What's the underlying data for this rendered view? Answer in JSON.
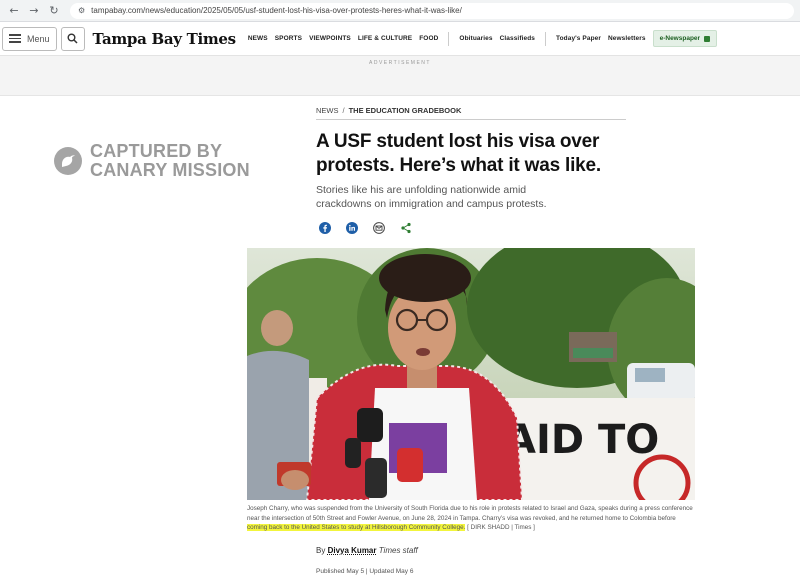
{
  "browser": {
    "url": "tampabay.com/news/education/2025/05/05/usf-student-lost-his-visa-over-protests-heres-what-it-was-like/"
  },
  "header": {
    "menu_label": "Menu",
    "logo": "Tampa Bay Times",
    "nav": [
      "NEWS",
      "SPORTS",
      "VIEWPOINTS",
      "LIFE & CULTURE",
      "FOOD"
    ],
    "nav_secondary": [
      "Obituaries",
      "Classifieds"
    ],
    "nav_tertiary": [
      "Today's Paper",
      "Newsletters"
    ],
    "epaper_label": "e-Newspaper"
  },
  "ad": {
    "label": "ADVERTISEMENT"
  },
  "watermark": {
    "line1": "CAPTURED BY",
    "line2": "CANARY MISSION"
  },
  "article": {
    "section": "NEWS",
    "subsection": "THE EDUCATION GRADEBOOK",
    "headline": "A USF student lost his visa over protests. Here’s what it was like.",
    "dek": "Stories like his are unfolding nationwide amid crackdowns on immigration and campus protests.",
    "caption_before": "Joseph Charry, who was suspended from the University of South Florida due to his role in protests related to Israel and Gaza, speaks during a press conference near the intersection of 50th Street and Fowler Avenue, on June 28, 2024 in Tampa. Charry’s visa was revoked, and he returned home to Colombia before ",
    "caption_highlight": "coming back to the United States to study at Hillsborough Community College.",
    "caption_after": " [ DIRK SHADD | Times ]",
    "byline_prefix": "By",
    "author": "Divya Kumar",
    "author_role": "Times staff",
    "published": "Published May 5 | Updated May 6"
  },
  "colors": {
    "facebook": "#1f5fa8",
    "linkedin": "#1f5fa8",
    "share_green": "#2e7d32",
    "highlight": "#f2f53c"
  }
}
